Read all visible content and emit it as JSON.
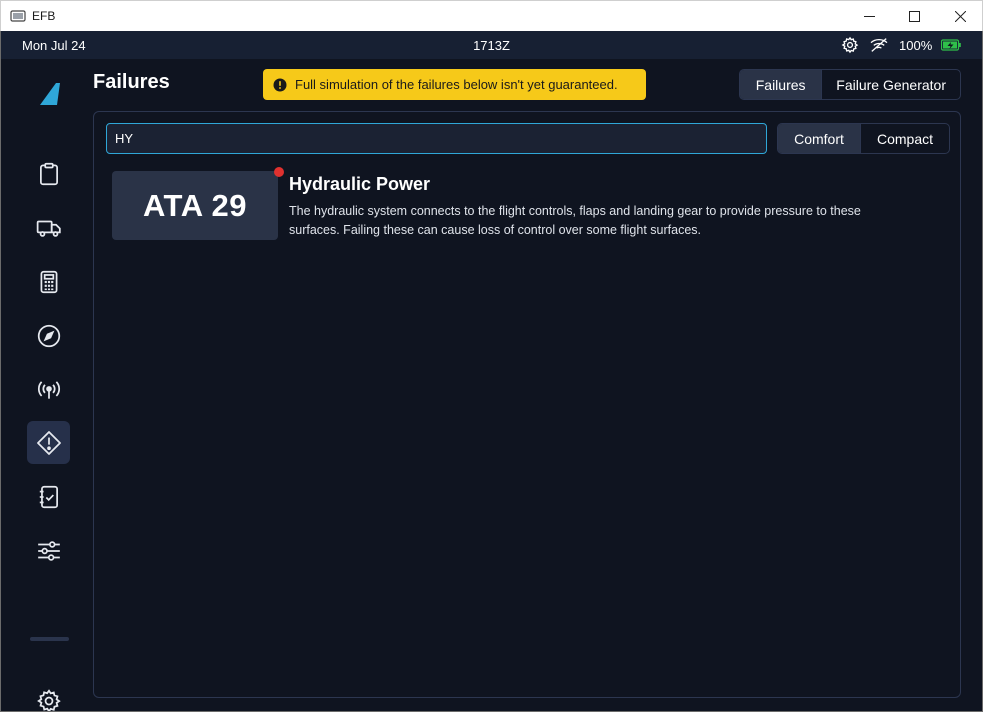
{
  "window": {
    "title": "EFB"
  },
  "status_bar": {
    "date": "Mon Jul 24",
    "zulu_time": "1713Z",
    "battery_percent": "100%",
    "icons": [
      "gear-icon",
      "signal-off-icon",
      "battery-charging-icon"
    ]
  },
  "sidebar": {
    "items": [
      {
        "name": "dashboard",
        "icon": "clipboard-icon"
      },
      {
        "name": "ground",
        "icon": "truck-icon"
      },
      {
        "name": "performance",
        "icon": "calculator-icon"
      },
      {
        "name": "navigation",
        "icon": "compass-icon"
      },
      {
        "name": "atc",
        "icon": "broadcast-icon"
      },
      {
        "name": "failures",
        "icon": "warning-diamond-icon",
        "active": true
      },
      {
        "name": "checklists",
        "icon": "checklist-icon"
      },
      {
        "name": "presets",
        "icon": "sliders-icon"
      }
    ],
    "bottom": {
      "name": "settings",
      "icon": "gear-icon"
    }
  },
  "header": {
    "title": "Failures",
    "warning": "Full simulation of the failures below isn't yet guaranteed.",
    "tabs": [
      {
        "label": "Failures",
        "active": true
      },
      {
        "label": "Failure Generator",
        "active": false
      }
    ]
  },
  "search": {
    "value": "HY",
    "placeholder": ""
  },
  "view_modes": [
    {
      "label": "Comfort",
      "active": true
    },
    {
      "label": "Compact",
      "active": false
    }
  ],
  "failures": [
    {
      "ata": "ATA 29",
      "title": "Hydraulic Power",
      "description": "The hydraulic system connects to the flight controls, flaps and landing gear to provide pressure to these surfaces. Failing these can cause loss of control over some flight surfaces.",
      "has_active_failure": true
    }
  ],
  "colors": {
    "background": "#0f1420",
    "status_bar": "#172033",
    "warning": "#f6c919",
    "accent": "#2fa7d8",
    "logo": "#2fa7d8",
    "active_dot": "#e0312f",
    "battery": "#2fbf4a"
  }
}
